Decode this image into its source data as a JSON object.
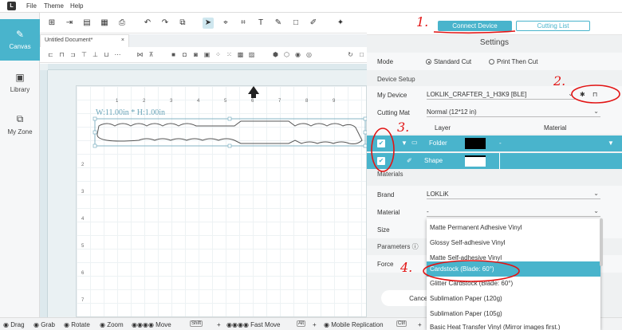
{
  "menubar": {
    "logo": "L",
    "file": "File",
    "theme": "Theme",
    "help": "Help"
  },
  "sidebar": {
    "items": [
      {
        "label": "Canvas",
        "icon": "canvas-icon"
      },
      {
        "label": "Library",
        "icon": "library-icon"
      },
      {
        "label": "My Zone",
        "icon": "my-zone-icon"
      }
    ]
  },
  "doc_tab": {
    "title": "Untitled Document*",
    "close": "×"
  },
  "canvas": {
    "dimensions": "W:11.00in * H:1.00in",
    "ruler_top": [
      "1",
      "2",
      "3",
      "4",
      "5",
      "6",
      "7",
      "8",
      "9",
      "1"
    ],
    "ruler_left": [
      "1",
      "2",
      "3",
      "4",
      "5",
      "6",
      "7",
      "8"
    ],
    "ruler_top2": [
      "1",
      "2",
      "3",
      "4",
      "5",
      "6",
      "7",
      "8",
      "9",
      "10"
    ]
  },
  "header": {
    "connect_device": "Connect Device",
    "cutting_list": "Cutting List"
  },
  "settings": {
    "title": "Settings",
    "mode_label": "Mode",
    "mode_standard": "Standard Cut",
    "mode_print": "Print Then Cut",
    "device_setup": "Device Setup",
    "my_device_label": "My Device",
    "my_device_value": "LOKLIK_CRAFTER_1_H3K9 [BLE]",
    "cutting_mat_label": "Cutting Mat",
    "cutting_mat_value": "Normal (12*12 in)",
    "layer_col": "Layer",
    "material_col": "Material",
    "layers": [
      {
        "name": "Folder",
        "material": "-"
      },
      {
        "name": "Shape",
        "material": ""
      }
    ],
    "materials_section": "Materials",
    "brand_label": "Brand",
    "brand_value": "LOKLiK",
    "material_label": "Material",
    "material_value": "-",
    "size_label": "Size",
    "parameters_label": "Parameters",
    "force_label": "Force",
    "cancel": "Cancel"
  },
  "material_options": [
    "Matte Permanent Adhesive Vinyl",
    "Glossy Self-adhesive Vinyl",
    "Matte Self-adhesive Vinyl",
    "Cardstock (Blade: 60°)",
    "Glitter Cardstock (Blade: 60°)",
    "Sublimation Paper (120g)",
    "Sublimation Paper (105g)",
    "Basic Heat Transfer Vinyl (Mirror images first.)"
  ],
  "annotations": [
    "1.",
    "2.",
    "3.",
    "4."
  ],
  "statusbar": {
    "drag": "Drag",
    "grab": "Grab",
    "rotate": "Rotate",
    "zoom": "Zoom",
    "move": "Move",
    "shift": "Shift",
    "plus1": "+",
    "fast_move": "Fast Move",
    "alt": "Alt",
    "plus2": "+",
    "mobile_replication": "Mobile Replication",
    "ctrl": "Ctrl",
    "plus3": "+"
  },
  "colors": {
    "accent": "#49b4cc",
    "annotation": "#e21414"
  }
}
